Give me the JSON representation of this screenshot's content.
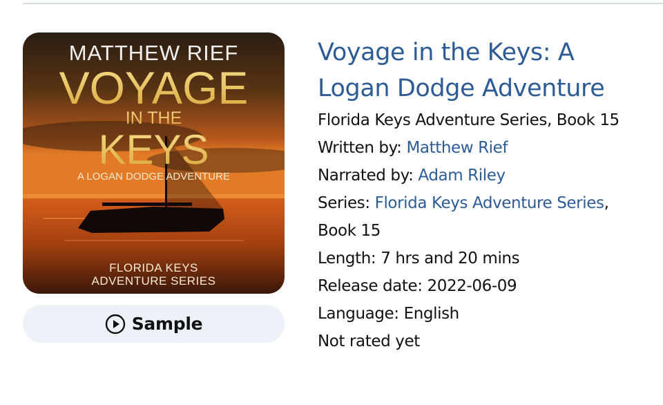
{
  "cover": {
    "author": "MATTHEW RIEF",
    "title_line1": "VOYAGE",
    "title_line2": "IN THE",
    "title_line3": "KEYS",
    "tagline": "A LOGAN DODGE ADVENTURE",
    "series_line1": "FLORIDA KEYS",
    "series_line2": "ADVENTURE SERIES"
  },
  "sample_button": {
    "label": "Sample",
    "icon": "play-circle-icon"
  },
  "book": {
    "title": "Voyage in the Keys: A Logan Dodge Adventure",
    "subtitle": "Florida Keys Adventure Series, Book 15",
    "written_by_label": "Written by:",
    "author": "Matthew Rief",
    "narrated_by_label": "Narrated by:",
    "narrator": "Adam Riley",
    "series_label": "Series:",
    "series_name": "Florida Keys Adventure Series",
    "series_comma": ",",
    "series_book": "Book 15",
    "length_label": "Length:",
    "length": "7 hrs and 20 mins",
    "release_label": "Release date:",
    "release_date": "2022-06-09",
    "language_label": "Language:",
    "language": "English",
    "rating": "Not rated yet"
  },
  "colors": {
    "link": "#2d5b96",
    "button_bg": "#edf2f9",
    "text": "#111111"
  }
}
